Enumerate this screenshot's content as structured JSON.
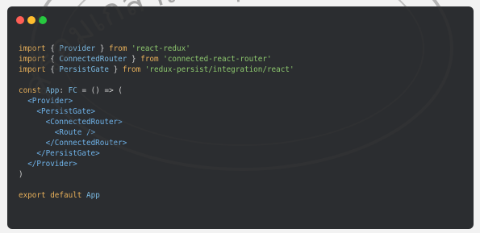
{
  "window": {
    "buttons": [
      {
        "name": "close",
        "color": "#ff5f56"
      },
      {
        "name": "minimize",
        "color": "#ffbd2e"
      },
      {
        "name": "zoom",
        "color": "#27c93f"
      }
    ]
  },
  "code": {
    "lines": [
      {
        "tokens": [
          [
            "k",
            "import"
          ],
          [
            "w",
            " "
          ],
          [
            "p",
            "{"
          ],
          [
            "w",
            " "
          ],
          [
            "n",
            "Provider"
          ],
          [
            "w",
            " "
          ],
          [
            "p",
            "}"
          ],
          [
            "w",
            " "
          ],
          [
            "k",
            "from"
          ],
          [
            "w",
            " "
          ],
          [
            "s",
            "'react-redux'"
          ]
        ]
      },
      {
        "tokens": [
          [
            "k",
            "import"
          ],
          [
            "w",
            " "
          ],
          [
            "p",
            "{"
          ],
          [
            "w",
            " "
          ],
          [
            "n",
            "ConnectedRouter"
          ],
          [
            "w",
            " "
          ],
          [
            "p",
            "}"
          ],
          [
            "w",
            " "
          ],
          [
            "k",
            "from"
          ],
          [
            "w",
            " "
          ],
          [
            "s",
            "'connected-react-router'"
          ]
        ]
      },
      {
        "tokens": [
          [
            "k",
            "import"
          ],
          [
            "w",
            " "
          ],
          [
            "p",
            "{"
          ],
          [
            "w",
            " "
          ],
          [
            "n",
            "PersistGate"
          ],
          [
            "w",
            " "
          ],
          [
            "p",
            "}"
          ],
          [
            "w",
            " "
          ],
          [
            "k",
            "from"
          ],
          [
            "w",
            " "
          ],
          [
            "s",
            "'redux-persist/integration/react'"
          ]
        ]
      },
      {
        "tokens": []
      },
      {
        "tokens": [
          [
            "k",
            "const"
          ],
          [
            "w",
            " "
          ],
          [
            "n",
            "App"
          ],
          [
            "p",
            ":"
          ],
          [
            "w",
            " "
          ],
          [
            "n",
            "FC"
          ],
          [
            "w",
            " "
          ],
          [
            "p",
            "="
          ],
          [
            "w",
            " "
          ],
          [
            "p",
            "()"
          ],
          [
            "w",
            " "
          ],
          [
            "p",
            "=>"
          ],
          [
            "w",
            " "
          ],
          [
            "p",
            "("
          ]
        ]
      },
      {
        "tokens": [
          [
            "w",
            "  "
          ],
          [
            "t",
            "<Provider>"
          ]
        ]
      },
      {
        "tokens": [
          [
            "w",
            "    "
          ],
          [
            "t",
            "<PersistGate>"
          ]
        ]
      },
      {
        "tokens": [
          [
            "w",
            "      "
          ],
          [
            "t",
            "<ConnectedRouter>"
          ]
        ]
      },
      {
        "tokens": [
          [
            "w",
            "        "
          ],
          [
            "t",
            "<Route />"
          ]
        ]
      },
      {
        "tokens": [
          [
            "w",
            "      "
          ],
          [
            "t",
            "</ConnectedRouter>"
          ]
        ]
      },
      {
        "tokens": [
          [
            "w",
            "    "
          ],
          [
            "t",
            "</PersistGate>"
          ]
        ]
      },
      {
        "tokens": [
          [
            "w",
            "  "
          ],
          [
            "t",
            "</Provider>"
          ]
        ]
      },
      {
        "tokens": [
          [
            "p",
            ")"
          ]
        ]
      },
      {
        "tokens": []
      },
      {
        "tokens": [
          [
            "k",
            "export"
          ],
          [
            "w",
            " "
          ],
          [
            "k",
            "default"
          ],
          [
            "w",
            " "
          ],
          [
            "n",
            "App"
          ]
        ]
      }
    ]
  },
  "watermark": {
    "text": "สร้อมเกล้าเจ้าคุณท",
    "color": "#3a3a3a"
  }
}
